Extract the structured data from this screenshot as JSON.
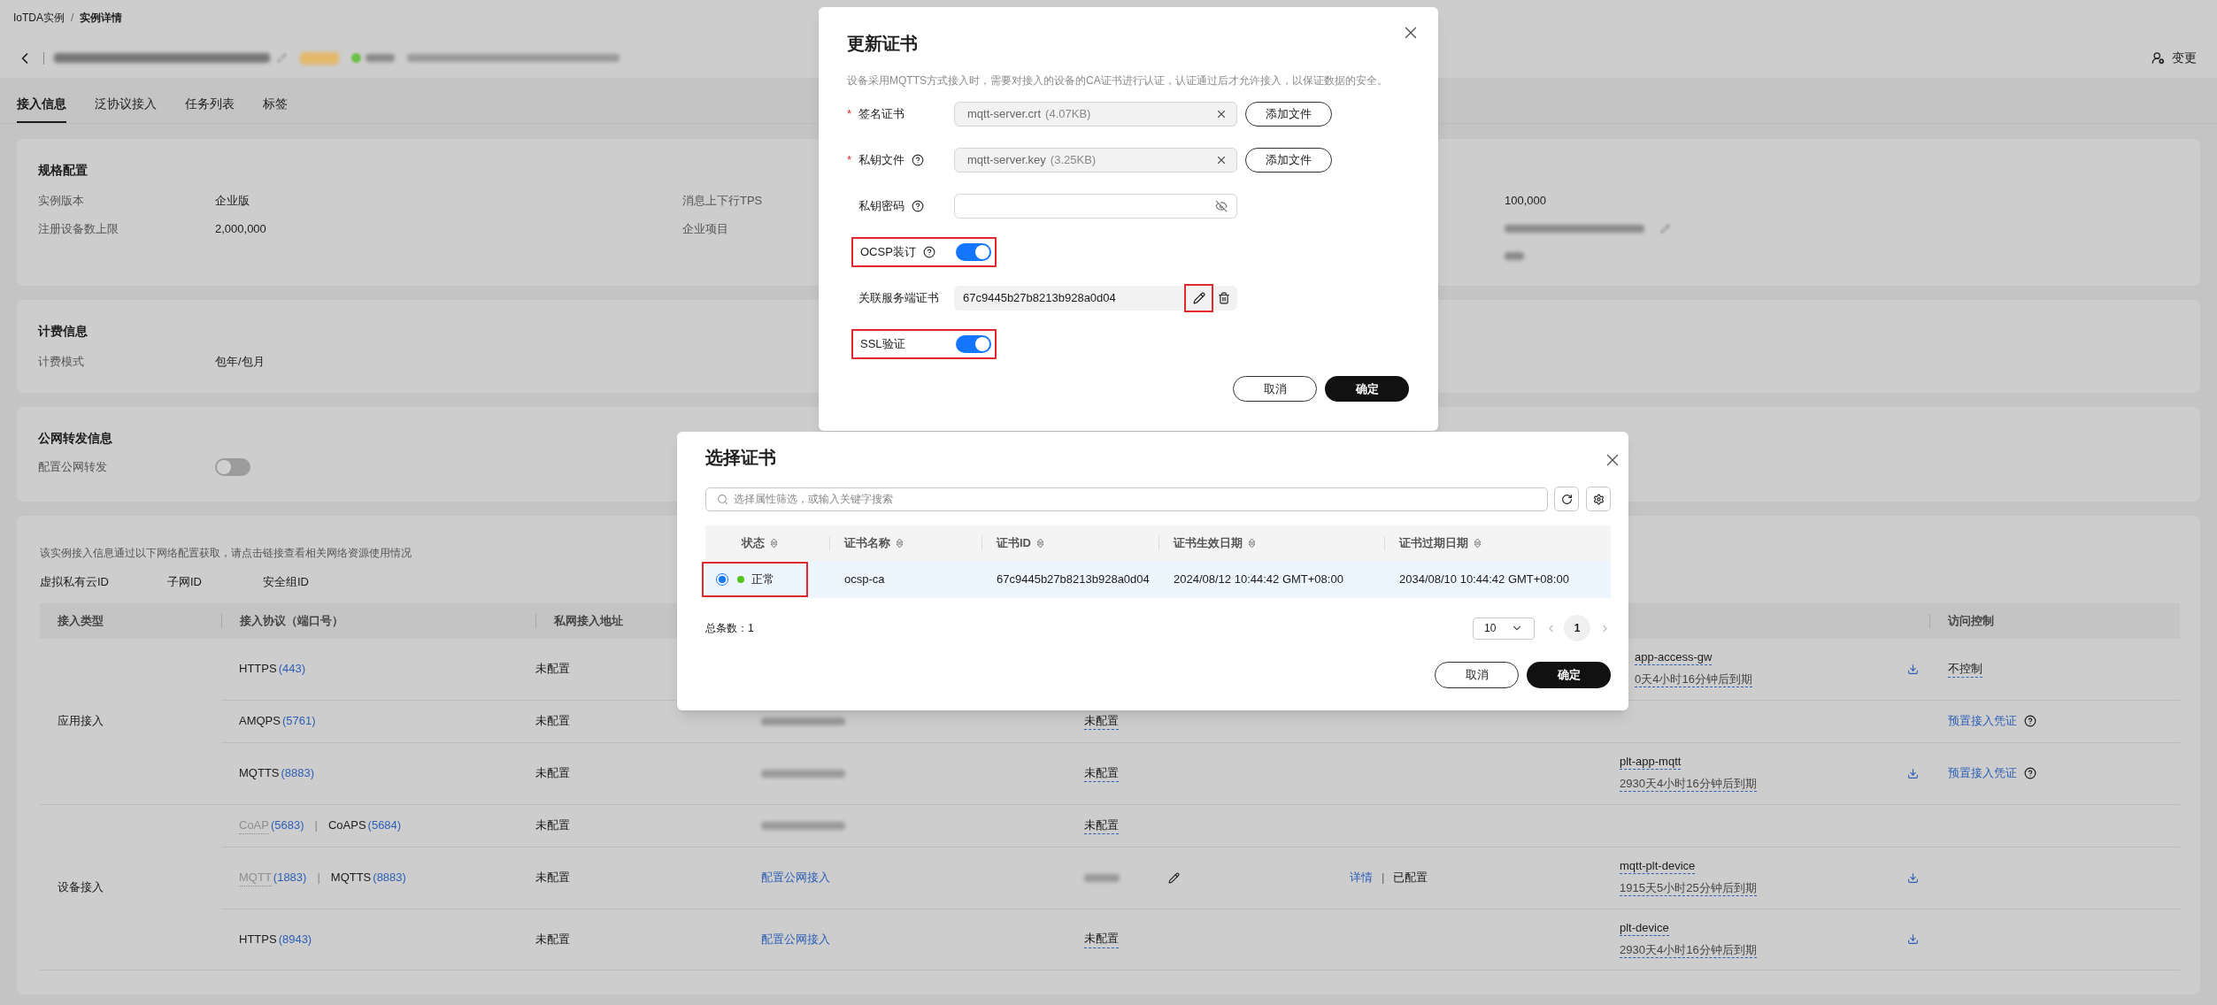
{
  "breadcrumb": {
    "items": [
      {
        "label": "IoTDA实例"
      },
      {
        "label": "实例详情"
      }
    ],
    "separator": "/"
  },
  "header": {
    "action": "变更"
  },
  "tabs": [
    {
      "label": "接入信息",
      "selected": true
    },
    {
      "label": "泛协议接入",
      "selected": false
    },
    {
      "label": "任务列表",
      "selected": false
    },
    {
      "label": "标签",
      "selected": false
    }
  ],
  "spec": {
    "title": "规格配置",
    "left": [
      {
        "label": "实例版本",
        "value": "企业版"
      },
      {
        "label": "注册设备数上限",
        "value": "2,000,000"
      }
    ],
    "right": [
      {
        "label": "消息上下行TPS",
        "value": "100,000"
      },
      {
        "label": "企业项目"
      }
    ]
  },
  "billing": {
    "title": "计费信息",
    "fields": [
      {
        "label": "计费模式",
        "value": "包年/包月"
      }
    ]
  },
  "forwarding": {
    "title": "公网转发信息",
    "fields": [
      {
        "label": "配置公网转发",
        "on": false
      }
    ]
  },
  "network": {
    "note": "该实例接入信息通过以下网络配置获取，请点击链接查看相关网络资源使用情况",
    "ids": [
      "虚拟私有云ID",
      "子网ID",
      "安全组ID"
    ],
    "columns": {
      "type": "接入类型",
      "protocol": "接入协议（端口号）",
      "private_address": "私网接入地址",
      "access_control": "访问控制"
    },
    "groups": [
      {
        "type": "应用接入",
        "rows": [
          {
            "protocols": [
              {
                "name": "HTTPS",
                "port": "(443)",
                "disabled": false
              }
            ],
            "private": "未配置",
            "certificate": {
              "name": "app-access-gw",
              "expiry": "0天4小时16分钟后到期",
              "partly_covered": true
            },
            "download": true,
            "access": {
              "kind": "dashed",
              "text": "不控制"
            }
          },
          {
            "protocols": [
              {
                "name": "AMQPS",
                "port": "(5761)",
                "disabled": false
              }
            ],
            "private": "未配置",
            "public_address": {
              "kind": "blurred"
            },
            "column_5": {
              "kind": "dashed",
              "text": "未配置"
            },
            "access": {
              "kind": "link_help",
              "text": "预置接入凭证"
            }
          },
          {
            "protocols": [
              {
                "name": "MQTTS",
                "port": "(8883)",
                "disabled": false
              }
            ],
            "private": "未配置",
            "public_address": {
              "kind": "blurred"
            },
            "column_5": {
              "kind": "dashed",
              "text": "未配置"
            },
            "certificate": {
              "name": "plt-app-mqtt",
              "expiry": "2930天4小时16分钟后到期"
            },
            "download": true,
            "access": {
              "kind": "link_help",
              "text": "预置接入凭证"
            }
          }
        ]
      },
      {
        "type": "设备接入",
        "rows": [
          {
            "protocols": [
              {
                "name": "CoAP",
                "port": "(5683)",
                "disabled": true
              },
              {
                "name": "CoAPS",
                "port": "(5684)",
                "disabled": false
              }
            ],
            "separator": "|",
            "private": "未配置",
            "public_address": {
              "kind": "blurred"
            },
            "column_5": {
              "kind": "dashed",
              "text": "未配置"
            }
          },
          {
            "protocols": [
              {
                "name": "MQTT",
                "port": "(1883)",
                "disabled": true
              },
              {
                "name": "MQTTS",
                "port": "(8883)",
                "disabled": false
              }
            ],
            "separator": "|",
            "private": "未配置",
            "public_address": {
              "kind": "link",
              "text": "配置公网接入"
            },
            "column_5": {
              "kind": "blurred_edit"
            },
            "column_6": {
              "link": "详情",
              "separator": "|",
              "status": "已配置"
            },
            "certificate": {
              "name": "mqtt-plt-device",
              "expiry": "1915天5小时25分钟后到期"
            },
            "download": true
          },
          {
            "protocols": [
              {
                "name": "HTTPS",
                "port": "(8943)",
                "disabled": false
              }
            ],
            "private": "未配置",
            "public_address": {
              "kind": "link",
              "text": "配置公网接入"
            },
            "column_5": {
              "kind": "dashed",
              "text": "未配置"
            },
            "certificate": {
              "name": "plt-device",
              "expiry": "2930天4小时16分钟后到期"
            },
            "download": true
          }
        ]
      }
    ]
  },
  "update_dialog": {
    "title": "更新证书",
    "required_mark": "*",
    "description": "设备采用MQTTS方式接入时，需要对接入的设备的CA证书进行认证，认证通过后才允许接入，以保证数据的安全。",
    "fields": [
      {
        "kind": "file",
        "required": true,
        "label": "签名证书",
        "help": false,
        "value": "mqtt-server.crt",
        "size": "(4.07KB)",
        "button": "添加文件"
      },
      {
        "kind": "file",
        "required": true,
        "label": "私钥文件",
        "help": true,
        "value": "mqtt-server.key",
        "size": "(3.25KB)",
        "button": "添加文件"
      },
      {
        "kind": "password",
        "required": false,
        "label": "私钥密码",
        "help": true
      },
      {
        "kind": "switch",
        "required": false,
        "label": "OCSP装订",
        "help": true,
        "on": true,
        "highlighted": true
      },
      {
        "kind": "cert",
        "required": false,
        "label": "关联服务端证书",
        "help": false,
        "value": "67c9445b27b8213b928a0d04",
        "highlighted": true
      },
      {
        "kind": "switch",
        "required": false,
        "label": "SSL验证",
        "help": false,
        "on": true,
        "highlighted": true
      }
    ],
    "buttons": {
      "cancel": "取消",
      "confirm": "确定"
    }
  },
  "select_dialog": {
    "title": "选择证书",
    "search": {
      "placeholder": "选择属性筛选，或输入关键字搜索"
    },
    "columns": [
      "状态",
      "证书名称",
      "证书ID",
      "证书生效日期",
      "证书过期日期"
    ],
    "rows": [
      {
        "selected": true,
        "highlighted": true,
        "status": "正常",
        "color": "#52c41a",
        "name": "ocsp-ca",
        "id": "67c9445b27b8213b928a0d04",
        "valid_from": "2024/08/12 10:44:42 GMT+08:00",
        "valid_to": "2034/08/10 10:44:42 GMT+08:00"
      }
    ],
    "total": "总条数：1",
    "page_size": "10",
    "pages": [
      {
        "label": "1",
        "selected": true
      }
    ],
    "buttons": {
      "cancel": "取消",
      "confirm": "确定"
    }
  }
}
